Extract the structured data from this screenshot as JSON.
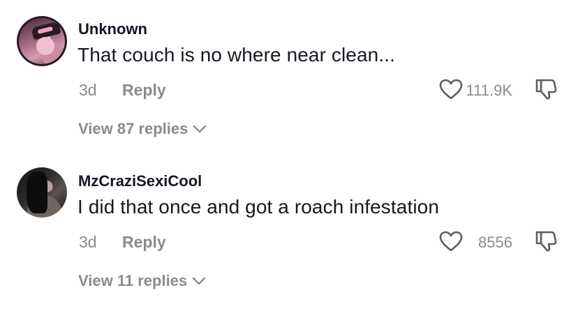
{
  "comments": [
    {
      "username": "Unknown",
      "text": "That couch is no where near clean...",
      "date": "3d",
      "reply_label": "Reply",
      "likes": "111.9K",
      "view_replies": "View 87 replies"
    },
    {
      "username": "MzCraziSexiCool",
      "text": "I did that once and got a roach infestation",
      "date": "3d",
      "reply_label": "Reply",
      "likes": "8556",
      "view_replies": "View 11 replies"
    }
  ],
  "icons": {
    "like": "heart-outline-icon",
    "dislike": "thumbs-down-outline-icon",
    "expand": "chevron-down-icon"
  },
  "colors": {
    "primary_text": "#161823",
    "secondary_text": "#8a8b91",
    "background": "#ffffff"
  }
}
